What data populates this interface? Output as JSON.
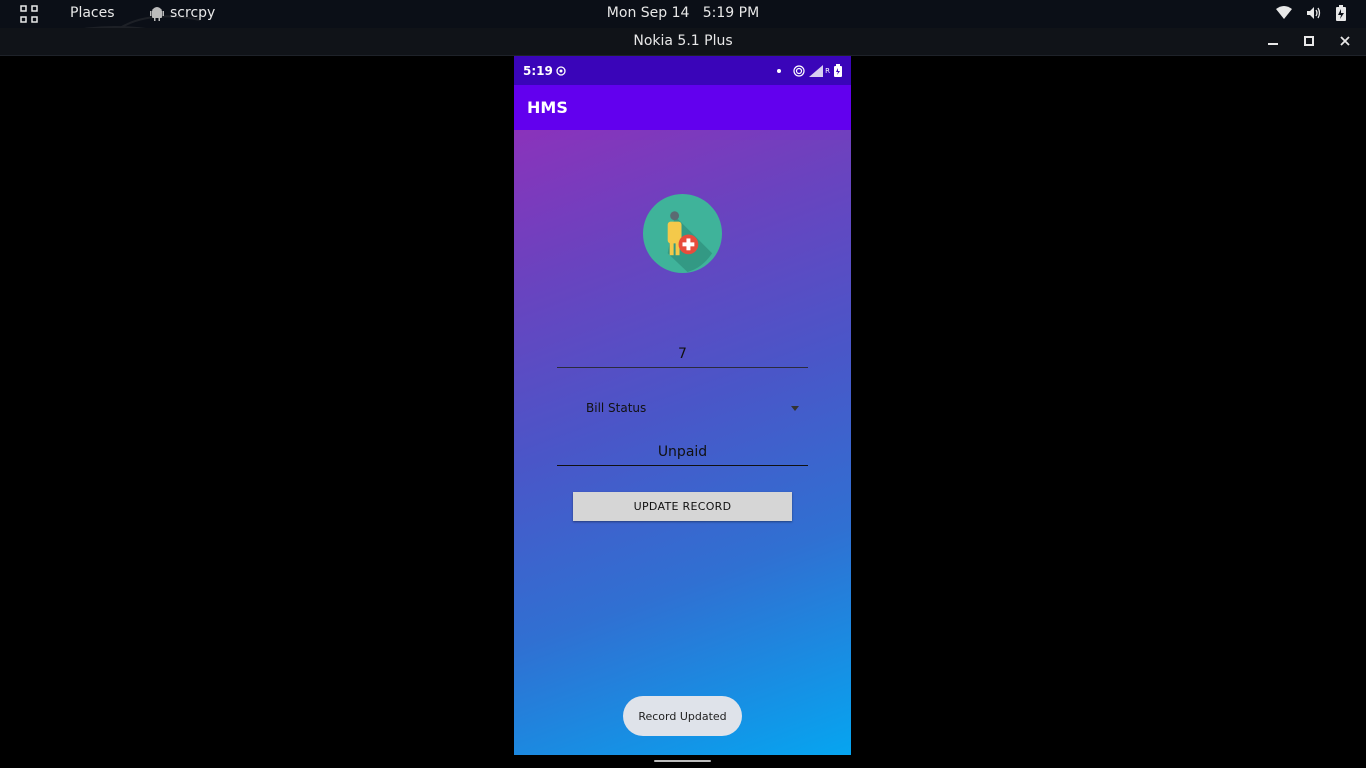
{
  "topbar": {
    "places": "Places",
    "app_name": "scrcpy",
    "clock": "Mon Sep 14   5:19 PM",
    "icons": [
      "grid-icon",
      "android-icon",
      "wifi-icon",
      "volume-icon",
      "battery-icon"
    ]
  },
  "window": {
    "title": "Nokia 5.1 Plus",
    "controls": [
      "minimize-icon",
      "maximize-icon",
      "close-icon"
    ]
  },
  "phone": {
    "status_time": "5:19",
    "network_label": "R",
    "app_title": "HMS",
    "id_field_value": "7",
    "spinner_value": "Bill Status",
    "status_field_value": "Unpaid",
    "update_button": "UPDATE RECORD",
    "toast": "Record Updated"
  },
  "colors": {
    "appbar": "#6200ee",
    "statusbar": "#3a05b9",
    "logo_circle": "#3fb39a",
    "logo_badge": "#e74c3c"
  }
}
